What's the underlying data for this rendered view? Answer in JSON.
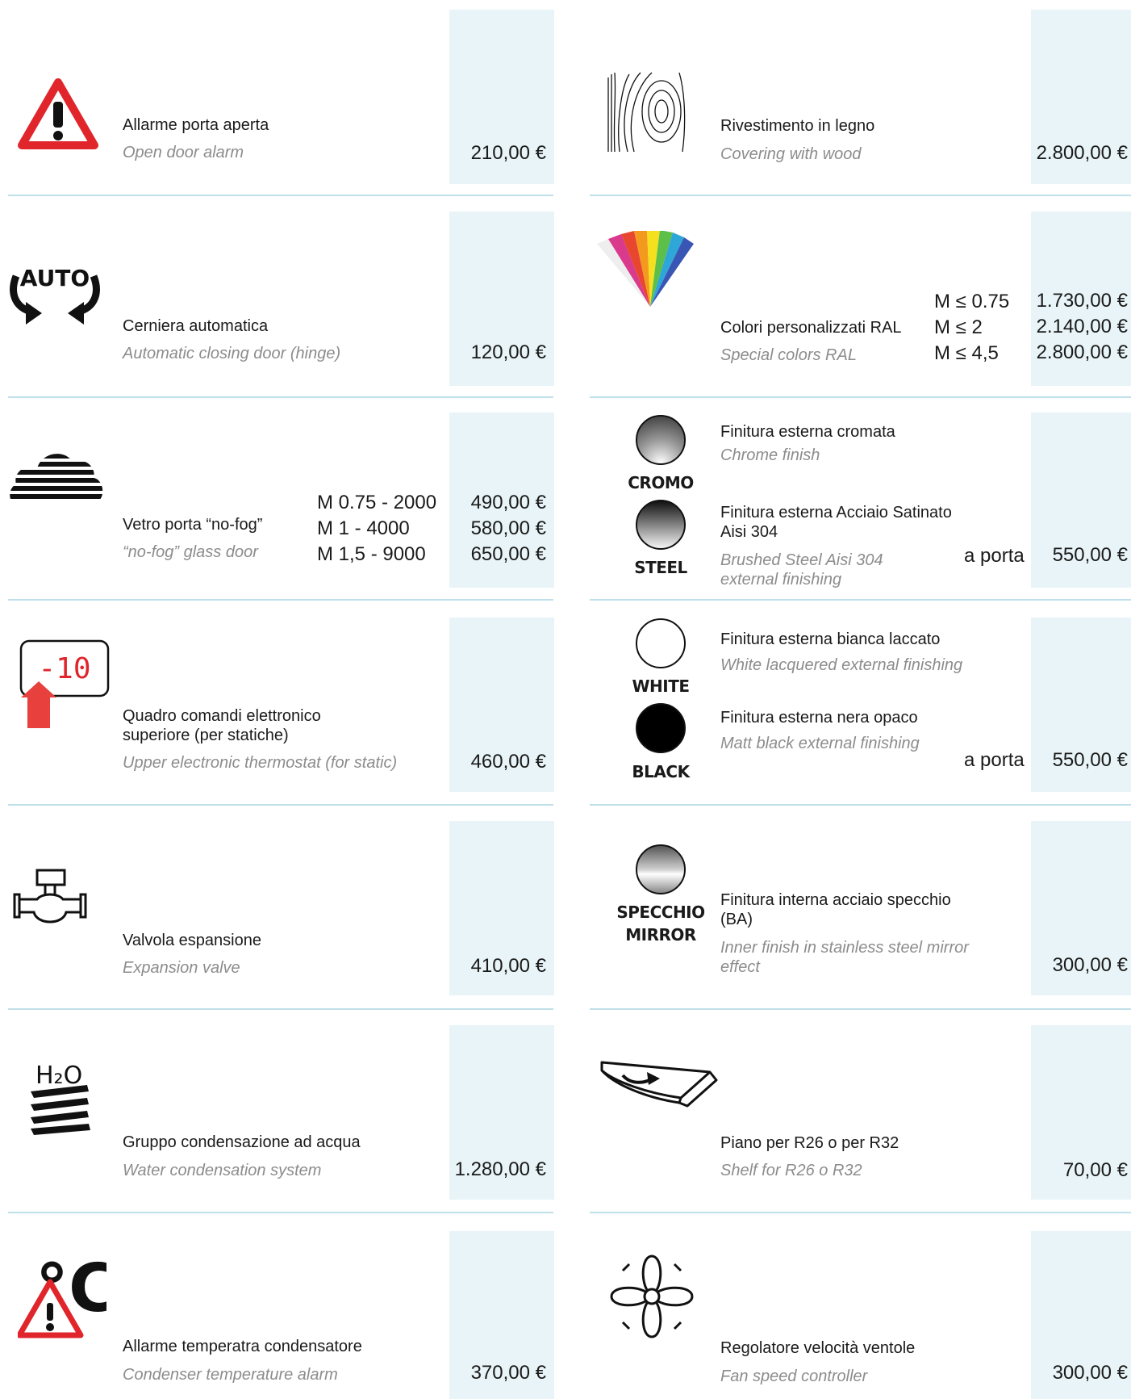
{
  "left": [
    {
      "name": "Allarme porta aperta",
      "en": "Open door alarm",
      "price": "210,00 €",
      "icon": "alarm-warning-icon"
    },
    {
      "name": "Cerniera automatica",
      "en": "Automatic closing door (hinge)",
      "price": "120,00 €",
      "icon": "auto-hinge-icon",
      "icon_text": "AUTO"
    },
    {
      "name": "Vetro porta “no-fog”",
      "en": "“no-fog” glass door",
      "icon": "no-fog-cloud-icon",
      "variants": [
        {
          "model": "M 0.75 - 2000",
          "price": "490,00 €"
        },
        {
          "model": "M 1 - 4000",
          "price": "580,00 €"
        },
        {
          "model": "M 1,5 - 9000",
          "price": "650,00 €"
        }
      ]
    },
    {
      "name": "Quadro comandi elettronico",
      "name2": "superiore (per statiche)",
      "en": "Upper electronic thermostat (for static)",
      "price": "460,00 €",
      "icon": "thermostat-display-icon",
      "display": "-10"
    },
    {
      "name": "Valvola espansione",
      "en": "Expansion valve",
      "price": "410,00 €",
      "icon": "valve-icon"
    },
    {
      "name": "Gruppo condensazione ad acqua",
      "en": "Water condensation system",
      "price": "1.280,00 €",
      "icon": "water-condensation-icon",
      "icon_text": "H₂O"
    },
    {
      "name": "Allarme temperatra condensatore",
      "en": "Condenser temperature alarm",
      "price": "370,00 €",
      "icon": "temperature-alarm-icon",
      "icon_text": "°C"
    }
  ],
  "right": [
    {
      "name": "Rivestimento in  legno",
      "en": "Covering with wood",
      "price": "2.800,00 €",
      "icon": "wood-grain-icon"
    },
    {
      "name": "Colori personalizzati RAL",
      "en": "Special colors RAL",
      "icon": "color-fan-icon",
      "variants": [
        {
          "model": "M ≤ 0.75",
          "price": "1.730,00 €"
        },
        {
          "model": "M ≤ 2",
          "price": "2.140,00 €"
        },
        {
          "model": "M ≤ 4,5",
          "price": "2.800,00 €"
        }
      ]
    },
    {
      "icon_label1": "CROMO",
      "icon_label2": "STEEL",
      "name1": "Finitura esterna cromata",
      "en1": "Chrome finish",
      "name2": "Finitura esterna Acciaio Satinato Aisi 304",
      "en2": "Brushed Steel Aisi 304 external finishing",
      "unit": "a porta",
      "price": "550,00 €"
    },
    {
      "icon_label1": "WHITE",
      "icon_label2": "BLACK",
      "name1": "Finitura esterna bianca laccato",
      "en1": "White lacquered external finishing",
      "name2": "Finitura esterna nera opaco",
      "en2": " Matt black external finishing",
      "unit": "a porta",
      "price": "550,00 €"
    },
    {
      "icon_label1": "SPECCHIO",
      "icon_label2": "MIRROR",
      "name": "Finitura interna acciaio specchio (BA)",
      "en": "Inner finish in stainless steel mirror effect",
      "price": "300,00 €"
    },
    {
      "name": "Piano per R26 o per R32",
      "en": "Shelf for R26 o R32",
      "price": "70,00 €",
      "icon": "shelf-icon"
    },
    {
      "name": "Regolatore velocità ventole",
      "en": "Fan speed controller",
      "price": "300,00 €",
      "icon": "fan-icon"
    }
  ],
  "colors": {
    "price_bg": "#e8f4f7",
    "separator": "#bfe0ea",
    "alarm_red": "#e0262b",
    "arrow_red": "#e8403c"
  }
}
